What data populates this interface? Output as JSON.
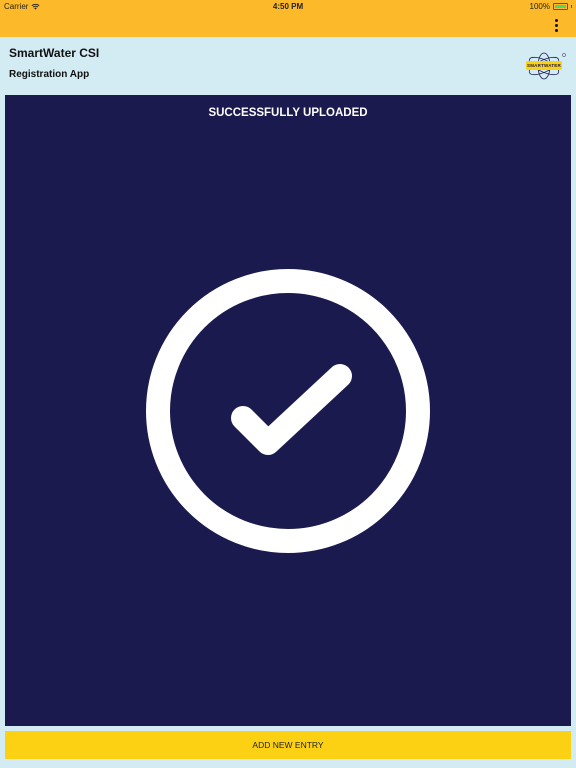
{
  "status_bar": {
    "carrier": "Carrier",
    "time": "4:50 PM",
    "battery": "100%"
  },
  "header": {
    "title": "SmartWater CSI",
    "subtitle": "Registration App",
    "logo_text": "SMARTWATER"
  },
  "main": {
    "status_message": "SUCCESSFULLY UPLOADED"
  },
  "footer": {
    "add_button_label": "ADD NEW ENTRY"
  },
  "colors": {
    "toolbar": "#fcb929",
    "header_background": "#d3ebf2",
    "panel_background": "#1b1a4e",
    "button_background": "#fcd113",
    "check_color": "#ffffff"
  },
  "icons": {
    "wifi": "wifi-icon",
    "battery": "battery-icon",
    "menu": "more-vertical-icon",
    "success": "check-circle-icon",
    "logo": "smartwater-atom-logo"
  }
}
